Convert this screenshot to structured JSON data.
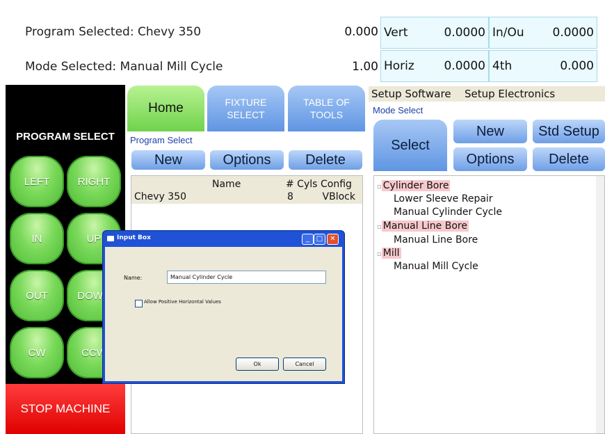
{
  "status": {
    "program_label": "Program Selected: Chevy 350",
    "mode_label": "Mode Selected: Manual Mill Cycle",
    "value1": "0.000",
    "value2": "1.00",
    "coords": [
      {
        "label": "Vert",
        "value": "0.0000"
      },
      {
        "label": "In/Ou",
        "value": "0.0000"
      },
      {
        "label": "Horiz",
        "value": "0.0000"
      },
      {
        "label": "4th",
        "value": "0.000"
      }
    ]
  },
  "left_panel": {
    "title": "PROGRAM SELECT",
    "buttons": [
      "LEFT",
      "RIGHT",
      "IN",
      "UP",
      "OUT",
      "DOWN",
      "CW",
      "CCW"
    ],
    "stop_label": "STOP MACHINE"
  },
  "tabs": {
    "home": "Home",
    "fixture": "FIXTURE SELECT",
    "tools": "TABLE OF TOOLS"
  },
  "program_select": {
    "title": "Program Select",
    "new": "New",
    "options": "Options",
    "delete": "Delete",
    "columns": [
      "Name",
      "# Cyls",
      "Config"
    ],
    "rows": [
      {
        "name": "Chevy 350",
        "cyls": "8",
        "config": "VBlock"
      }
    ]
  },
  "setup": {
    "menu": [
      "Setup Software",
      "Setup Electronics"
    ],
    "mode_select_title": "Mode Select",
    "select": "Select",
    "new": "New",
    "std_setup": "Std Setup",
    "options": "Options",
    "delete": "Delete",
    "tree": [
      {
        "label": "Cylinder Bore",
        "children": [
          "Lower Sleeve Repair",
          "Manual Cylinder Cycle"
        ]
      },
      {
        "label": "Manual Line Bore",
        "children": [
          "Manual Line Bore"
        ]
      },
      {
        "label": "Mill",
        "children": [
          "Manual Mill Cycle"
        ]
      }
    ]
  },
  "dialog": {
    "title": "Input Box",
    "name_label": "Name:",
    "name_value": "Manual Cylinder Cycle",
    "checkbox_label": "Allow Positive Horizontal Values",
    "ok": "Ok",
    "cancel": "Cancel"
  }
}
